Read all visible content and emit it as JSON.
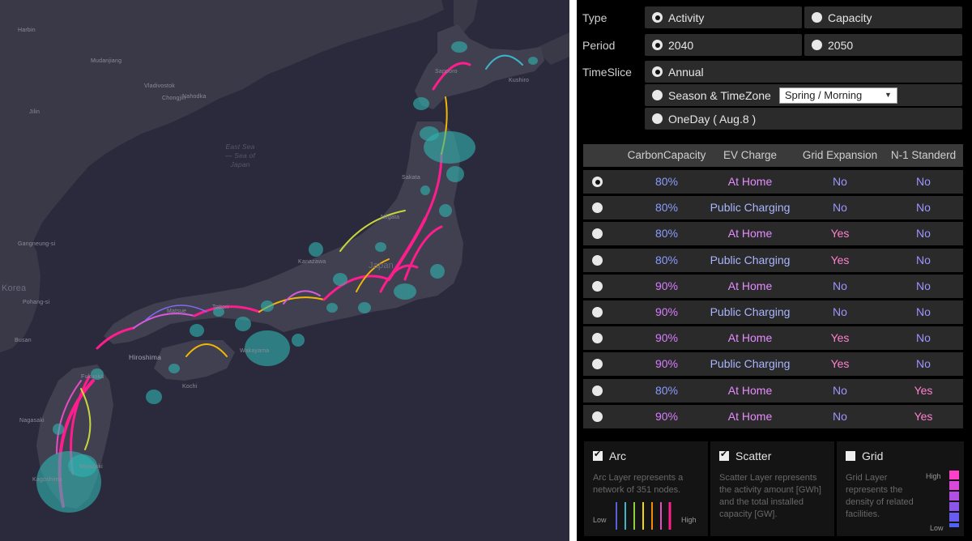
{
  "map": {
    "places": [
      {
        "name": "Harbin",
        "cls": ""
      },
      {
        "name": "Vladivostok",
        "cls": ""
      },
      {
        "name": "Mudanjiang",
        "cls": ""
      },
      {
        "name": "Jilin",
        "cls": ""
      },
      {
        "name": "Chongjin",
        "cls": ""
      },
      {
        "name": "Nahodka",
        "cls": ""
      },
      {
        "name": "East Sea\n— Sea of\nJapan",
        "cls": "sea"
      },
      {
        "name": "Gangneung-si",
        "cls": ""
      },
      {
        "name": "Korea",
        "cls": "country"
      },
      {
        "name": "Pohang-si",
        "cls": ""
      },
      {
        "name": "Busan",
        "cls": ""
      },
      {
        "name": "Sapporo",
        "cls": ""
      },
      {
        "name": "Kushiro",
        "cls": ""
      },
      {
        "name": "Sakata",
        "cls": ""
      },
      {
        "name": "Niigata",
        "cls": ""
      },
      {
        "name": "Kanazawa",
        "cls": ""
      },
      {
        "name": "Japan",
        "cls": "country"
      },
      {
        "name": "Matsue",
        "cls": ""
      },
      {
        "name": "Tottori",
        "cls": ""
      },
      {
        "name": "Hiroshima",
        "cls": "mid"
      },
      {
        "name": "Wakayama",
        "cls": ""
      },
      {
        "name": "Kochi",
        "cls": ""
      },
      {
        "name": "Fukuoka",
        "cls": ""
      },
      {
        "name": "Nagasaki",
        "cls": ""
      },
      {
        "name": "Miyazaki",
        "cls": ""
      },
      {
        "name": "Kagoshima",
        "cls": ""
      }
    ]
  },
  "panel": {
    "type_label": "Type",
    "period_label": "Period",
    "timeslice_label": "TimeSlice",
    "type_options": [
      "Activity",
      "Capacity"
    ],
    "period_options": [
      "2040",
      "2050"
    ],
    "timeslice_options": [
      "Annual",
      "Season & TimeZone",
      "OneDay ( Aug.8 )"
    ],
    "season_select": "Spring / Morning",
    "scenario_headers": [
      "CarbonCapacity",
      "EV Charge",
      "Grid Expansion",
      "N-1 Standerd"
    ],
    "scenarios": [
      {
        "carbon": "80%",
        "ev": "At Home",
        "grid": "No",
        "n1": "No"
      },
      {
        "carbon": "80%",
        "ev": "Public Charging",
        "grid": "No",
        "n1": "No"
      },
      {
        "carbon": "80%",
        "ev": "At Home",
        "grid": "Yes",
        "n1": "No"
      },
      {
        "carbon": "80%",
        "ev": "Public Charging",
        "grid": "Yes",
        "n1": "No"
      },
      {
        "carbon": "90%",
        "ev": "At Home",
        "grid": "No",
        "n1": "No"
      },
      {
        "carbon": "90%",
        "ev": "Public Charging",
        "grid": "No",
        "n1": "No"
      },
      {
        "carbon": "90%",
        "ev": "At Home",
        "grid": "Yes",
        "n1": "No"
      },
      {
        "carbon": "90%",
        "ev": "Public Charging",
        "grid": "Yes",
        "n1": "No"
      },
      {
        "carbon": "80%",
        "ev": "At Home",
        "grid": "No",
        "n1": "Yes"
      },
      {
        "carbon": "90%",
        "ev": "At Home",
        "grid": "No",
        "n1": "Yes"
      }
    ],
    "layers": {
      "arc": {
        "title": "Arc",
        "desc": "Arc Layer represents a network of 351 nodes.",
        "low": "Low",
        "high": "High"
      },
      "scatter": {
        "title": "Scatter",
        "desc": "Scatter Layer represents the activity amount [GWh] and the total installed capacity [GW]."
      },
      "grid": {
        "title": "Grid",
        "desc": "Grid Layer represents the density of related facilities.",
        "low": "Low",
        "high": "High"
      }
    }
  },
  "colors": {
    "value_80": "#8a9bff",
    "value_90": "#d97cff",
    "at_home": "#e58cff",
    "public_charging": "#a9b6ff",
    "no": "#9b96ff",
    "yes": "#ff80d0",
    "scatter": "#2fb5b0",
    "arc_high": "#ff1d8e"
  }
}
